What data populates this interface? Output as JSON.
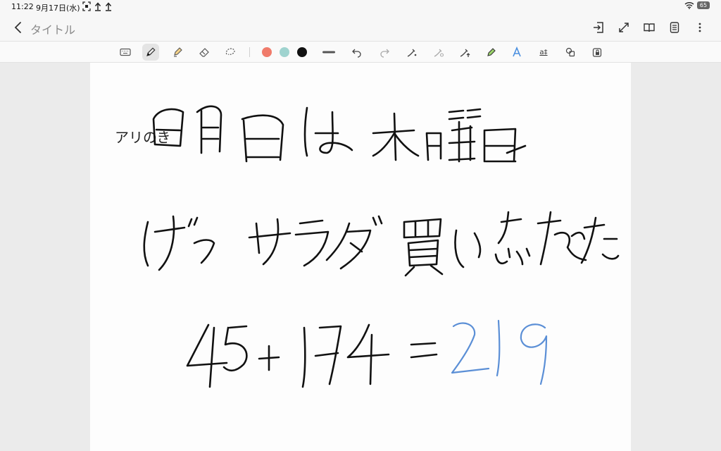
{
  "status_bar": {
    "time": "11:22",
    "date": "9月17日(水)",
    "battery": "65"
  },
  "nav": {
    "title": "タイトル"
  },
  "toolbar": {
    "colors": {
      "salmon": "#f07b6b",
      "mint": "#9fd3cf",
      "black": "#111111"
    },
    "text_tool_label": "a‡"
  },
  "note": {
    "typed_text": "アリのき",
    "handwriting_lines": [
      "明日は木曜日",
      "げっサラダ買い忘れた",
      "45+174=219"
    ],
    "ink_colors": {
      "main": "#111111",
      "answer": "#5b8fd6"
    }
  }
}
